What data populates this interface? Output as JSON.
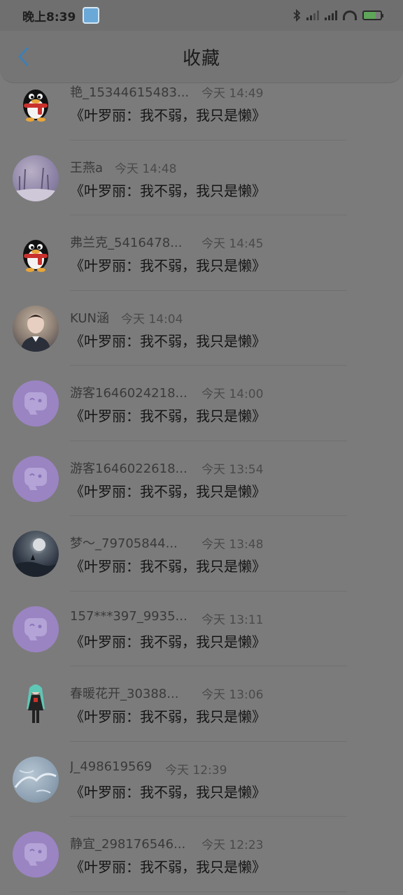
{
  "status_bar": {
    "time": "晚上8:39",
    "icons": [
      "app-icon",
      "bluetooth-icon",
      "signal-icon",
      "hd-signal-icon",
      "wifi-icon",
      "battery-icon"
    ]
  },
  "header": {
    "title": "收藏",
    "back_icon": "chevron-left-icon"
  },
  "colors": {
    "back_accent": "#3f7fb3",
    "overlay_background": "#7b7b7b"
  },
  "items": [
    {
      "name": "艳_15344615483...",
      "time": "今天 14:49",
      "message": "《叶罗丽：我不弱，我只是懒》",
      "avatar": "penguin"
    },
    {
      "name": "王燕a",
      "time": "今天 14:48",
      "message": "《叶罗丽：我不弱，我只是懒》",
      "avatar": "winter"
    },
    {
      "name": "弗兰克_5416478...",
      "time": "今天 14:45",
      "message": "《叶罗丽：我不弱，我只是懒》",
      "avatar": "penguin"
    },
    {
      "name": "KUN涵",
      "time": "今天 14:04",
      "message": "《叶罗丽：我不弱，我只是懒》",
      "avatar": "person"
    },
    {
      "name": "游客1646024218...",
      "time": "今天 14:00",
      "message": "《叶罗丽：我不弱，我只是懒》",
      "avatar": "purple"
    },
    {
      "name": "游客1646022618...",
      "time": "今天 13:54",
      "message": "《叶罗丽：我不弱，我只是懒》",
      "avatar": "purple"
    },
    {
      "name": "梦～_79705844...",
      "time": "今天 13:48",
      "message": "《叶罗丽：我不弱，我只是懒》",
      "avatar": "moon"
    },
    {
      "name": "157***397_9935...",
      "time": "今天 13:11",
      "message": "《叶罗丽：我不弱，我只是懒》",
      "avatar": "purple"
    },
    {
      "name": "春暖花开_30388...",
      "time": "今天 13:06",
      "message": "《叶罗丽：我不弱，我只是懒》",
      "avatar": "girl"
    },
    {
      "name": "J_498619569",
      "time": "今天 12:39",
      "message": "《叶罗丽：我不弱，我只是懒》",
      "avatar": "sky"
    },
    {
      "name": "静宜_298176546...",
      "time": "今天 12:23",
      "message": "《叶罗丽：我不弱，我只是懒》",
      "avatar": "purple"
    }
  ]
}
